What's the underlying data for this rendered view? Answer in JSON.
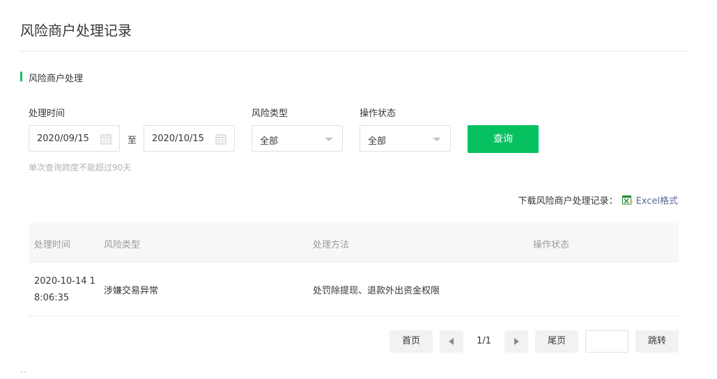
{
  "page": {
    "title": "风险商户处理记录"
  },
  "section": {
    "title": "风险商户处理"
  },
  "filters": {
    "time_label": "处理时间",
    "start_date": "2020/09/15",
    "range_separator": "至",
    "end_date": "2020/10/15",
    "risk_type_label": "风险类型",
    "risk_type_value": "全部",
    "status_label": "操作状态",
    "status_value": "全部",
    "query_button": "查询",
    "hint": "单次查询跨度不能超过90天"
  },
  "download": {
    "label": "下载风险商户处理记录：",
    "link": "Excel格式"
  },
  "table": {
    "columns": [
      "处理时间",
      "风险类型",
      "处理方法",
      "操作状态"
    ],
    "rows": [
      {
        "time": "2020-10-14 18:06:35",
        "risk_type": "涉嫌交易异常",
        "method": "处罚除提现、退款外出资金权限",
        "status": ""
      }
    ]
  },
  "pagination": {
    "first": "首页",
    "page_info": "1/1",
    "last": "尾页",
    "jump_input": "",
    "jump": "跳转"
  },
  "stray_mark": "``",
  "colors": {
    "accent": "#07c160",
    "link": "#576b95"
  }
}
